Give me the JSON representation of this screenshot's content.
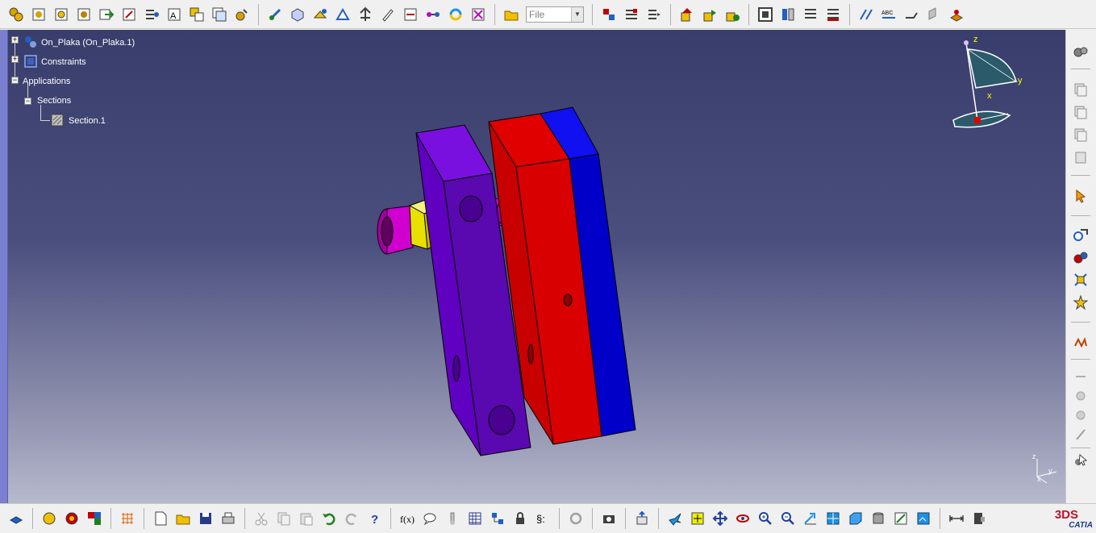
{
  "top_toolbar": {
    "file_combo_value": "File",
    "icons": [
      "assembly-gear-icon",
      "insert-product-icon",
      "insert-part-icon",
      "existing-component-icon",
      "replace-component-icon",
      "graph-tree-icon",
      "generate-numbering-icon",
      "selective-load-icon",
      "manage-representations-icon",
      "multi-instantiation-icon",
      "sketch-icon",
      "manipulation-icon",
      "snap-icon",
      "smart-move-icon",
      "explode-icon",
      "stop-manipulate-icon",
      "clash-icon",
      "reconnect-icon",
      "update-icon",
      "constraint-icon",
      "open-folder-icon",
      "space-analysis-icon",
      "bill-of-material-icon",
      "sections-icon",
      "save-management-icon",
      "publish-icon",
      "annotation-icon",
      "view-icon",
      "catalog-icon",
      "dimensions-icon",
      "text-icon",
      "measure-icon",
      "apply-material-icon",
      "paint-icon"
    ]
  },
  "right_toolbar": {
    "icons": [
      "gear-icon",
      "copy-icon",
      "paste-icon",
      "special-paste-icon",
      "delete-icon",
      "select-arrow-icon",
      "constraint-coincidence-icon",
      "constraint-contact-icon",
      "constraint-offset-icon",
      "constraint-angle-icon",
      "fix-component-icon",
      "fix-together-icon",
      "quick-constraint-icon",
      "flexible-rigid-icon",
      "change-constraint-icon",
      "reuse-pattern-icon",
      "select-icon"
    ]
  },
  "bottom_toolbar": {
    "icons": [
      "cube-icon",
      "graph-icon",
      "catalog-browser-icon",
      "color-palette-icon",
      "grid-icon",
      "new-icon",
      "open-icon",
      "save-icon",
      "print-icon",
      "cut-icon",
      "copy-icon",
      "paste-icon",
      "undo-icon",
      "redo-icon",
      "whats-this-icon",
      "formula-icon",
      "comment-icon",
      "thermometer-icon",
      "table-icon",
      "knowledge-icon",
      "lock-icon",
      "macro-icon",
      "loop-icon",
      "capture-icon",
      "publication-icon",
      "fly-mode-icon",
      "fit-all-icon",
      "pan-icon",
      "rotate-icon",
      "zoom-in-icon",
      "zoom-out-icon",
      "normal-view-icon",
      "iso-view-icon",
      "box-view-icon",
      "render-style-icon",
      "hide-show-icon",
      "swap-view-icon",
      "measure-between-icon",
      "measure-item-icon"
    ]
  },
  "tree": {
    "root": {
      "label": "On_Plaka (On_Plaka.1)"
    },
    "constraints": {
      "label": "Constraints"
    },
    "applications": {
      "label": "Applications"
    },
    "sections": {
      "label": "Sections"
    },
    "section1": {
      "label": "Section.1"
    }
  },
  "compass": {
    "z_label": "z",
    "y_label": "y",
    "x_label": "x"
  },
  "axis_triad": {
    "z_label": "z",
    "y_label": "y",
    "x_label": "x"
  },
  "logo": {
    "brand": "CATIA",
    "mark": "3DS"
  },
  "colors": {
    "viewport_top": "#393d6b",
    "viewport_bottom": "#b7b9cd",
    "purple_plate": "#5a08b0",
    "red_plate": "#e00000",
    "blue_plate": "#0000c8",
    "nut": "#e8e000",
    "bolt": "#c000c0"
  }
}
